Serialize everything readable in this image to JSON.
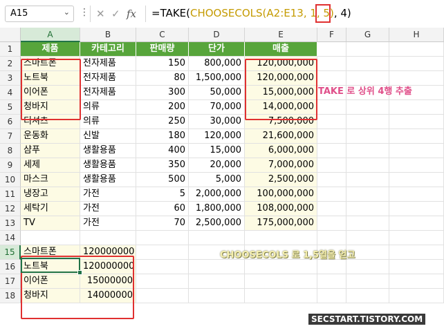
{
  "name_box": "A15",
  "formula_parts": [
    "=TAKE(",
    "CHOOSECOLS(",
    "A2:E13, 1, 5)",
    ", ",
    "4",
    ")"
  ],
  "columns": [
    "A",
    "B",
    "C",
    "D",
    "E",
    "F",
    "G",
    "H"
  ],
  "rows": [
    "1",
    "2",
    "3",
    "4",
    "5",
    "6",
    "7",
    "8",
    "9",
    "10",
    "11",
    "12",
    "13",
    "14",
    "15",
    "16",
    "17",
    "18"
  ],
  "header": [
    "제품",
    "카테고리",
    "판매량",
    "단가",
    "매출"
  ],
  "table": [
    [
      "스마트폰",
      "전자제품",
      "150",
      "800,000",
      "120,000,000"
    ],
    [
      "노트북",
      "전자제품",
      "80",
      "1,500,000",
      "120,000,000"
    ],
    [
      "이어폰",
      "전자제품",
      "300",
      "50,000",
      "15,000,000"
    ],
    [
      "청바지",
      "의류",
      "200",
      "70,000",
      "14,000,000"
    ],
    [
      "티셔츠",
      "의류",
      "250",
      "30,000",
      "7,500,000"
    ],
    [
      "운동화",
      "신발",
      "180",
      "120,000",
      "21,600,000"
    ],
    [
      "샴푸",
      "생활용품",
      "400",
      "15,000",
      "6,000,000"
    ],
    [
      "세제",
      "생활용품",
      "350",
      "20,000",
      "7,000,000"
    ],
    [
      "마스크",
      "생활용품",
      "500",
      "5,000",
      "2,500,000"
    ],
    [
      "냉장고",
      "가전",
      "5",
      "2,000,000",
      "100,000,000"
    ],
    [
      "세탁기",
      "가전",
      "60",
      "1,800,000",
      "108,000,000"
    ],
    [
      "TV",
      "가전",
      "70",
      "2,500,000",
      "175,000,000"
    ]
  ],
  "result": [
    [
      "스마트폰",
      "120000000"
    ],
    [
      "노트북",
      "120000000"
    ],
    [
      "이어폰",
      "15000000"
    ],
    [
      "청바지",
      "14000000"
    ]
  ],
  "annotations": {
    "take": "TAKE 로 상위 4행 추출",
    "choosecols": "CHOOSECOLS 로 1,5열을 얻고",
    "watermark": "SECSTART.TISTORY.COM"
  },
  "colors": {
    "header_bg": "#57a53b",
    "highlight_red": "#e03030",
    "choosecols_color": "#c49a00",
    "excel_green": "#217346"
  }
}
